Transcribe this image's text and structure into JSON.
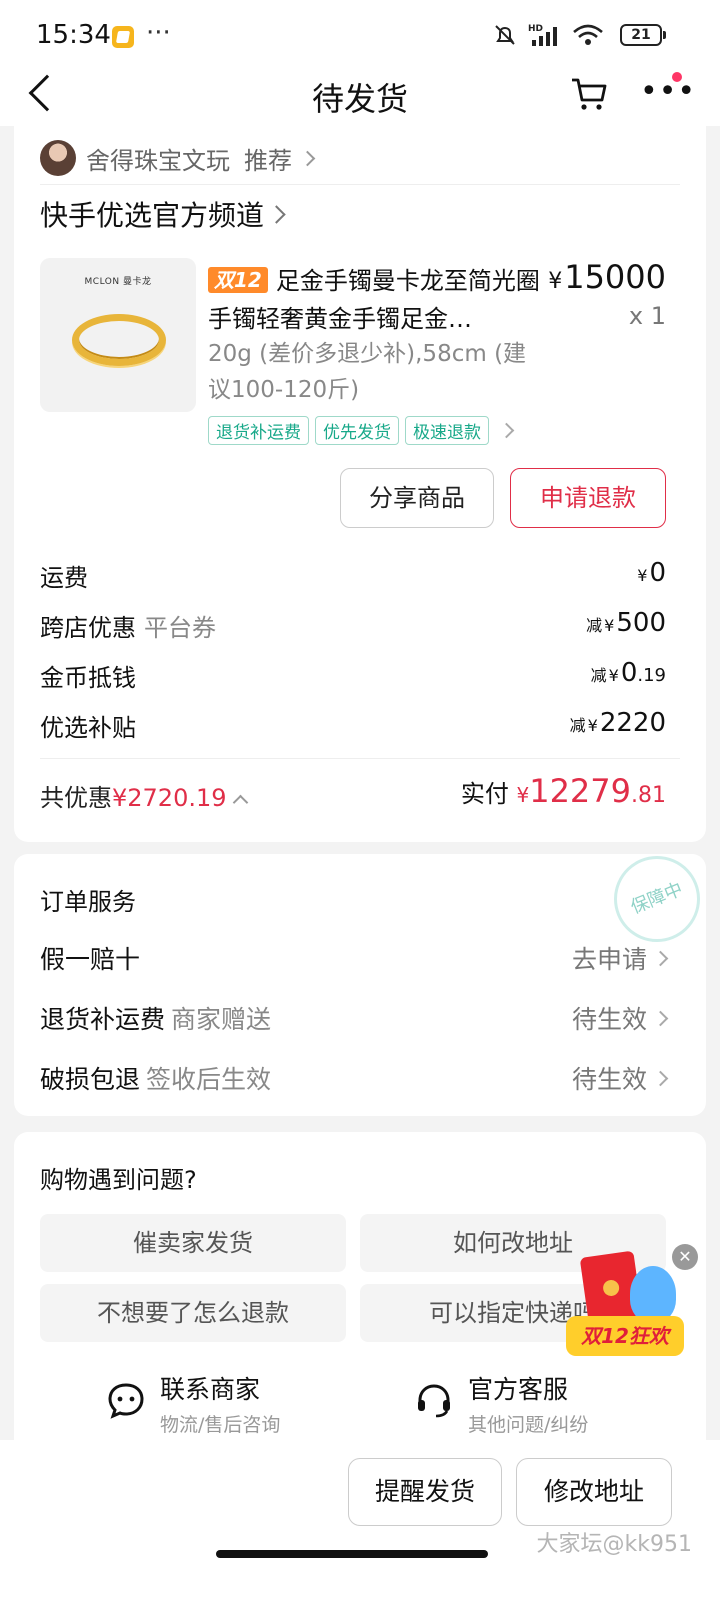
{
  "status_bar": {
    "time": "15:34",
    "dots": "···",
    "battery": "21",
    "network_label": "HD"
  },
  "nav": {
    "title": "待发货"
  },
  "shop": {
    "name": "舍得珠宝文玩",
    "recommend": "推荐"
  },
  "channel": {
    "label": "快手优选官方频道"
  },
  "product": {
    "brand": "MCLON 曼卡龙",
    "promo_tag": "双12",
    "title": "足金手镯曼卡龙至简光圈手镯轻奢黄金手镯足金…",
    "price_symbol": "¥",
    "price": "15000",
    "qty": "x 1",
    "spec": "20g (差价多退少补),58cm (建议100-120斤)",
    "badges": [
      "退货补运费",
      "优先发货",
      "极速退款"
    ],
    "share_button": "分享商品",
    "refund_button": "申请退款"
  },
  "fees": [
    {
      "label": "运费",
      "sub": "",
      "prefix": "",
      "symbol": "¥",
      "amount": "0",
      "dec": ""
    },
    {
      "label": "跨店优惠",
      "sub": "平台券",
      "prefix": "减",
      "symbol": "¥",
      "amount": "500",
      "dec": ""
    },
    {
      "label": "金币抵钱",
      "sub": "",
      "prefix": "减",
      "symbol": "¥",
      "amount": "0",
      "dec": ".19"
    },
    {
      "label": "优选补贴",
      "sub": "",
      "prefix": "减",
      "symbol": "¥",
      "amount": "2220",
      "dec": ""
    }
  ],
  "totals": {
    "discount_label": "共优惠",
    "discount_value": "¥2720.19",
    "paid_label": "实付",
    "paid_symbol": "¥",
    "paid_int": "12279",
    "paid_dec": ".81"
  },
  "services": {
    "title": "订单服务",
    "stamp": "保障中",
    "rows": [
      {
        "label": "假一赔十",
        "sub": "",
        "status": "去申请"
      },
      {
        "label": "退货补运费",
        "sub": "商家赠送",
        "status": "待生效"
      },
      {
        "label": "破损包退",
        "sub": "签收后生效",
        "status": "待生效"
      }
    ]
  },
  "help": {
    "title": "购物遇到问题?",
    "questions": [
      "催卖家发货",
      "如何改地址",
      "不想要了怎么退款",
      "可以指定快递吗"
    ],
    "contact_merchant": {
      "title": "联系商家",
      "sub": "物流/售后咨询"
    },
    "contact_official": {
      "title": "官方客服",
      "sub": "其他问题/纠纷"
    }
  },
  "promo_float": {
    "text": "双12狂欢",
    "close": "✕"
  },
  "bottom_bar": {
    "remind": "提醒发货",
    "change_address": "修改地址",
    "watermark": "大家坛@kk951"
  }
}
